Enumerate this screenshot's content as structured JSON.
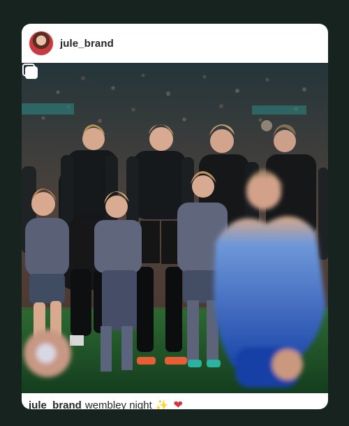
{
  "post": {
    "username": "jule_brand",
    "caption": {
      "handle": "jule_brand",
      "text": "wembley night"
    },
    "emoji": [
      "sparkles-icon",
      "heart-icon"
    ],
    "media_icon": "multiple-images-icon"
  },
  "colors": {
    "page_background": "#17231f",
    "card_background": "#ffffff",
    "username_text": "#262626"
  }
}
